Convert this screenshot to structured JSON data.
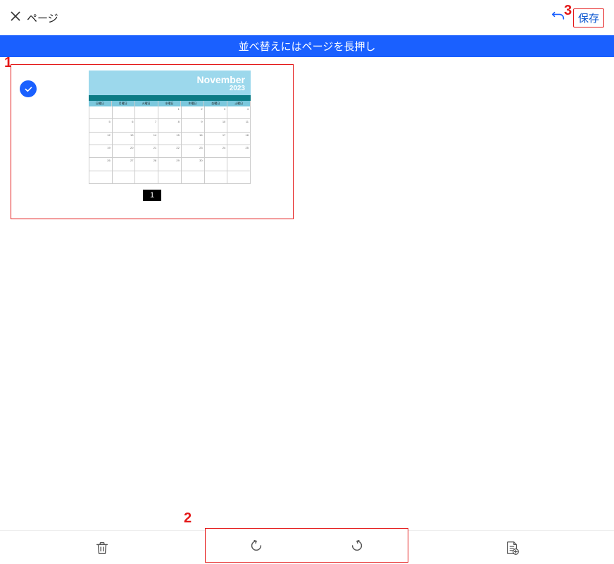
{
  "header": {
    "title": "ページ",
    "save_label": "保存"
  },
  "banner": {
    "text": "並べ替えにはページを長押し"
  },
  "thumbnail": {
    "page_number": "1",
    "calendar": {
      "month": "November",
      "year": "2023",
      "day_headers": [
        "日曜日",
        "月曜日",
        "火曜日",
        "水曜日",
        "木曜日",
        "金曜日",
        "土曜日"
      ],
      "cells": [
        "",
        "",
        "",
        "1",
        "2",
        "3",
        "4",
        "5",
        "6",
        "7",
        "8",
        "9",
        "10",
        "11",
        "12",
        "13",
        "14",
        "15",
        "16",
        "17",
        "18",
        "19",
        "20",
        "21",
        "22",
        "23",
        "24",
        "25",
        "26",
        "27",
        "28",
        "29",
        "30",
        "",
        "",
        "",
        "",
        "",
        "",
        "",
        "",
        ""
      ]
    }
  },
  "annotations": {
    "a1": "1",
    "a2": "2",
    "a3": "3"
  },
  "colors": {
    "accent_blue": "#1a60ff",
    "annotation_red": "#e41818",
    "cal_light": "#9cd8ec",
    "cal_dark": "#0b7b85"
  }
}
